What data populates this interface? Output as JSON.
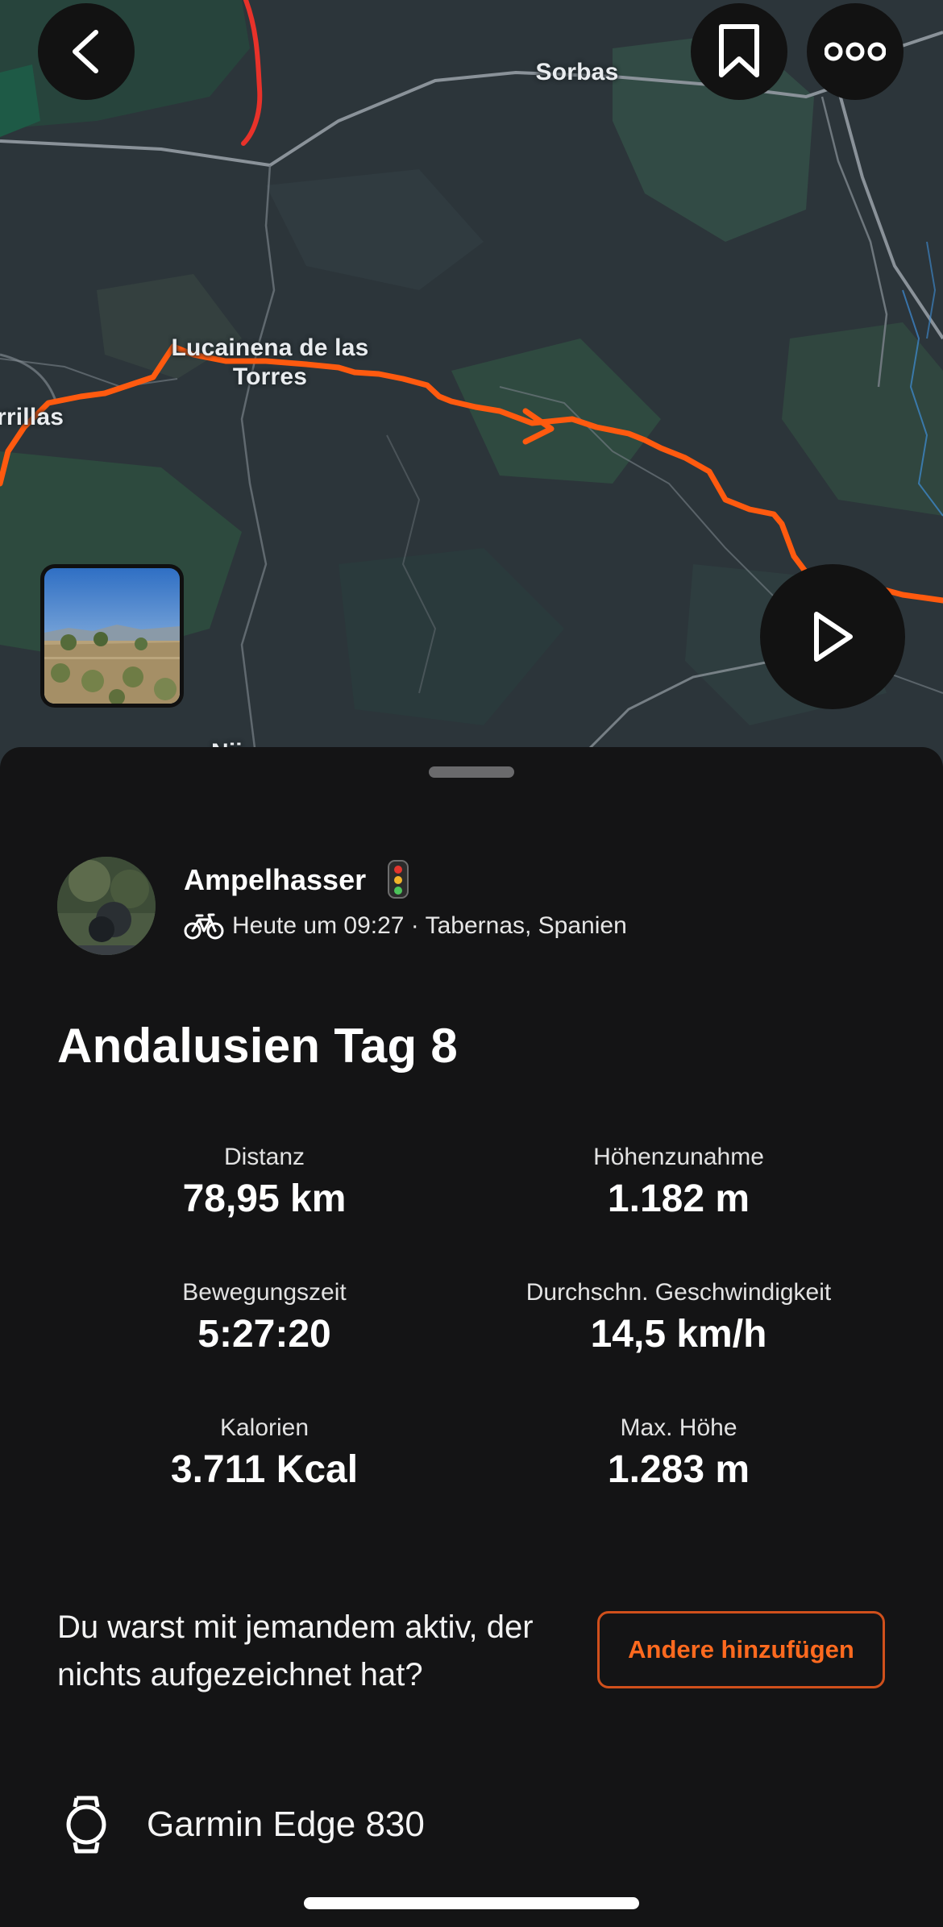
{
  "map": {
    "labels": [
      {
        "id": "sorbas",
        "text": "Sorbas"
      },
      {
        "id": "lucainena",
        "text": "Lucainena de las\nTorres"
      },
      {
        "id": "rillas",
        "text": "rrillas"
      },
      {
        "id": "partial",
        "text": "Nĳ"
      }
    ],
    "route_color": "#ff5a0f",
    "segment_color": "#e8322a",
    "buttons": {
      "back_icon": "chevron-left-icon",
      "bookmark_icon": "bookmark-icon",
      "more_icon": "more-horizontal-icon",
      "play_icon": "play-icon"
    },
    "photo_thumbnail": "landscape-photo"
  },
  "athlete": {
    "name": "Ampelhasser",
    "emoji": "traffic-light-emoji",
    "sport_icon": "bike-icon",
    "meta": "Heute um 09:27 · Tabernas, Spanien"
  },
  "activity": {
    "title": "Andalusien Tag 8"
  },
  "stats": [
    {
      "label": "Distanz",
      "value": "78,95 km"
    },
    {
      "label": "Höhenzunahme",
      "value": "1.182 m"
    },
    {
      "label": "Bewegungszeit",
      "value": "5:27:20"
    },
    {
      "label": "Durchschn. Geschwindigkeit",
      "value": "14,5 km/h"
    },
    {
      "label": "Kalorien",
      "value": "3.711 Kcal"
    },
    {
      "label": "Max. Höhe",
      "value": "1.283 m"
    }
  ],
  "group_prompt": {
    "text": "Du warst mit jemandem aktiv, der nichts aufgezeichnet hat?",
    "button_label": "Andere hinzufügen"
  },
  "device": {
    "icon": "watch-icon",
    "name": "Garmin Edge 830"
  },
  "colors": {
    "accent": "#ff6a1f",
    "background": "#141415",
    "map_base": "#2c353a"
  }
}
